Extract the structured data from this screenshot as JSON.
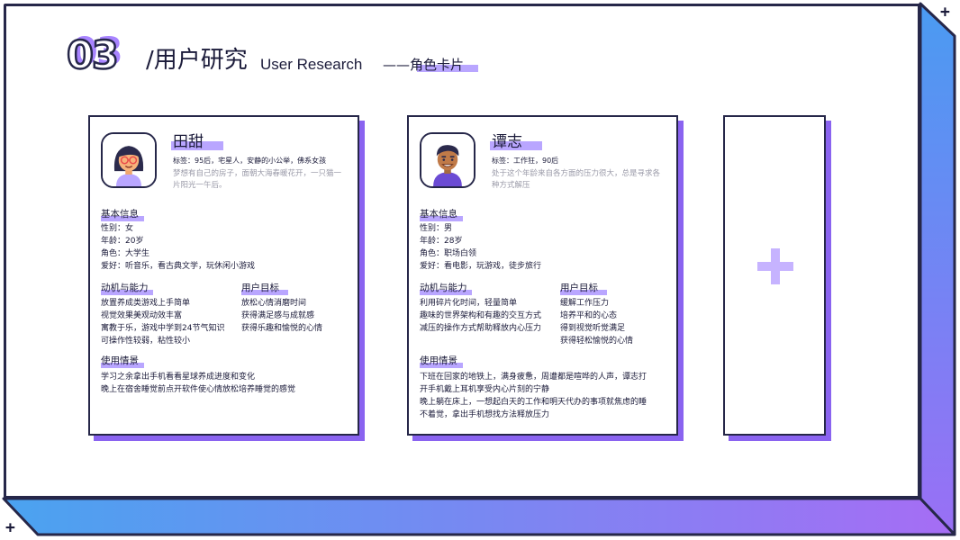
{
  "title": {
    "number": "03",
    "zh": "/用户研究",
    "en": "User Research",
    "sub": "——角色卡片"
  },
  "colors": {
    "accent": "#b9a6ff",
    "accent_dark": "#8a63f0",
    "ink": "#262749"
  },
  "cards": [
    {
      "name": "田甜",
      "avatar_icon": "female-avatar-icon",
      "tags": "标签：95后，宅星人，安静的小公举，佛系女孩",
      "desc": [
        "梦想有自己的房子，面朝大海春暖花开，一只猫一",
        "片阳光一午后。"
      ],
      "basic": {
        "title": "基本信息",
        "lines": [
          "性别：女",
          "年龄：20岁",
          "角色：大学生",
          "爱好：听音乐，看古典文学，玩休闲小游戏"
        ]
      },
      "motivation": {
        "title": "动机与能力",
        "lines": [
          "放置养成类游戏上手简单",
          "视觉效果美观动效丰富",
          "寓教于乐，游戏中学到24节气知识",
          "可操作性较弱，粘性较小"
        ]
      },
      "goals": {
        "title": "用户目标",
        "lines": [
          "放松心情消磨时间",
          "获得满足感与成就感",
          "获得乐趣和愉悦的心情"
        ]
      },
      "scenario": {
        "title": "使用情景",
        "lines": [
          "学习之余拿出手机看看星球养成进度和变化",
          "晚上在宿舍睡觉前点开软件使心情放松培养睡觉的感觉"
        ]
      }
    },
    {
      "name": "谭志",
      "avatar_icon": "male-avatar-icon",
      "tags": "标签：工作狂，90后",
      "desc": [
        "处于这个年龄来自各方面的压力很大，总是寻求各",
        "种方式解压"
      ],
      "basic": {
        "title": "基本信息",
        "lines": [
          "性别：男",
          "年龄：28岁",
          "角色：职场白领",
          "爱好：看电影，玩游戏，徒步旅行"
        ]
      },
      "motivation": {
        "title": "动机与能力",
        "lines": [
          "利用碎片化时间，轻量简单",
          "趣味的世界架构和有趣的交互方式",
          "减压的操作方式帮助释放内心压力"
        ]
      },
      "goals": {
        "title": "用户目标",
        "lines": [
          "缓解工作压力",
          "培养平和的心态",
          "得到视觉听觉满足",
          "获得轻松愉悦的心情"
        ]
      },
      "scenario": {
        "title": "使用情景",
        "lines": [
          "下班在回家的地铁上，满身疲惫，周遭都是喧哗的人声，谭志打",
          "开手机戴上耳机享受内心片刻的宁静",
          "晚上躺在床上，一想起白天的工作和明天代办的事项就焦虑的睡",
          "不着觉，拿出手机想找方法释放压力"
        ]
      }
    }
  ],
  "add_card": {
    "icon": "plus-icon"
  }
}
